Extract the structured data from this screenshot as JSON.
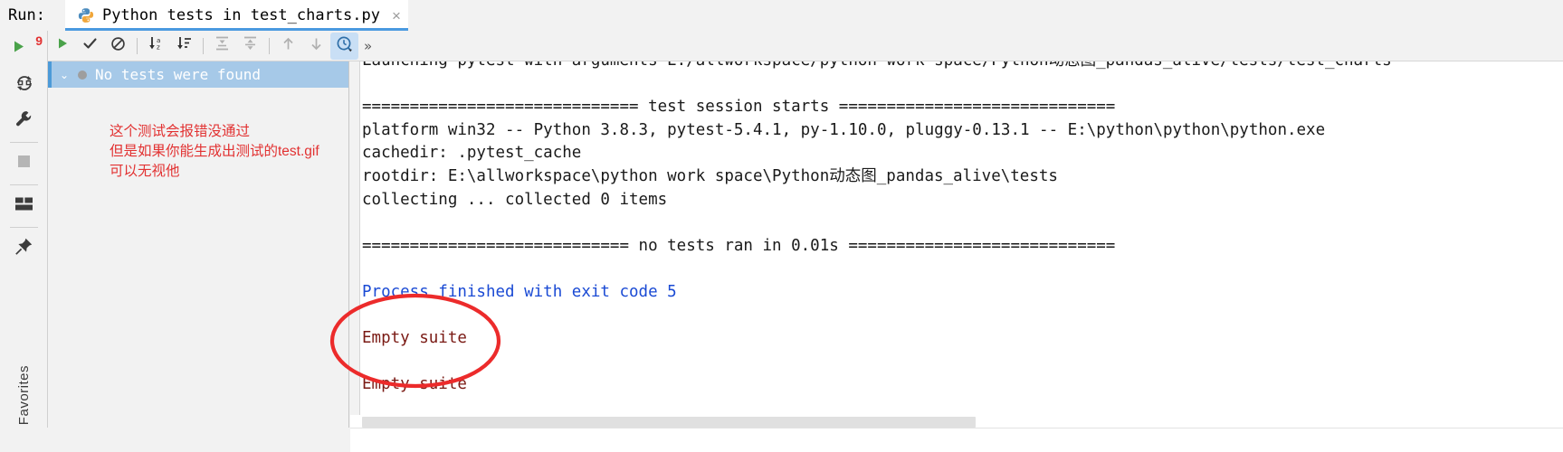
{
  "window": {
    "run_label": "Run:",
    "accent_color": "#4a9ae0",
    "annotation_color": "#e23232"
  },
  "tab": {
    "title": "Python tests in test_charts.py",
    "icon": "python-icon",
    "close_glyph": "×"
  },
  "toolbar": {
    "buttons": [
      {
        "name": "rerun-button",
        "icon": "play-icon",
        "label": "Rerun"
      },
      {
        "name": "show-passed-button",
        "icon": "checkmark-icon",
        "label": "Show Passed"
      },
      {
        "name": "show-ignored-button",
        "icon": "no-entry-icon",
        "label": "Show Ignored"
      },
      {
        "name": "sort-alphabetically-button",
        "icon": "sort-alpha-icon",
        "label": "Sort Alphabetically"
      },
      {
        "name": "sort-by-duration-button",
        "icon": "sort-duration-icon",
        "label": "Sort by Duration"
      },
      {
        "name": "expand-all-button",
        "icon": "expand-all-icon",
        "label": "Expand All"
      },
      {
        "name": "collapse-all-button",
        "icon": "collapse-all-icon",
        "label": "Collapse All"
      },
      {
        "name": "previous-failed-button",
        "icon": "arrow-up-icon",
        "label": "Previous Failed Test"
      },
      {
        "name": "next-failed-button",
        "icon": "arrow-down-icon",
        "label": "Next Failed Test"
      },
      {
        "name": "test-history-button",
        "icon": "clock-history-icon",
        "label": "Test History"
      }
    ],
    "more_glyph": "»"
  },
  "rail": {
    "items": [
      {
        "name": "rerun-tests-button",
        "icon": "play-with-badge-icon",
        "badge": "9"
      },
      {
        "name": "rerun-failed-button",
        "icon": "rerun-loop-icon",
        "badge": ""
      },
      {
        "name": "settings-button",
        "icon": "wrench-icon",
        "badge": ""
      },
      {
        "name": "stop-button",
        "icon": "stop-square-icon",
        "badge": ""
      },
      {
        "name": "layout-button",
        "icon": "layout-icon",
        "badge": ""
      },
      {
        "name": "pin-tab-button",
        "icon": "pin-icon",
        "badge": ""
      }
    ],
    "favorites_label": "Favorites",
    "favorites_icon": "star-icon"
  },
  "tree": {
    "chevron_glyph": "⌄",
    "root_label": "No tests were found",
    "status_icon": "gray-dot-icon"
  },
  "annotation": {
    "lines": [
      "这个测试会报错没通过",
      "但是如果你能生成出测试的test.gif",
      "可以无视他"
    ],
    "ellipse_name": "red-ellipse-annotation"
  },
  "console": {
    "lines": [
      {
        "text": "Launching pytest with arguments E:/allworkspace/python work space/Python动态图_pandas_alive/tests/test_charts",
        "color": "default"
      },
      {
        "text": "",
        "color": "default"
      },
      {
        "text": "============================= test session starts =============================",
        "color": "default"
      },
      {
        "text": "platform win32 -- Python 3.8.3, pytest-5.4.1, py-1.10.0, pluggy-0.13.1 -- E:\\python\\python\\python.exe",
        "color": "default"
      },
      {
        "text": "cachedir: .pytest_cache",
        "color": "default"
      },
      {
        "text": "rootdir: E:\\allworkspace\\python work space\\Python动态图_pandas_alive\\tests",
        "color": "default"
      },
      {
        "text": "collecting ... collected 0 items",
        "color": "default"
      },
      {
        "text": "",
        "color": "default"
      },
      {
        "text": "============================ no tests ran in 0.01s ============================",
        "color": "default"
      },
      {
        "text": "",
        "color": "default"
      },
      {
        "text": "Process finished with exit code 5",
        "color": "blue"
      },
      {
        "text": "",
        "color": "default"
      },
      {
        "text": "Empty suite",
        "color": "maroon"
      },
      {
        "text": "",
        "color": "default"
      },
      {
        "text": "Empty suite",
        "color": "maroon"
      }
    ]
  },
  "scrollbar": {
    "name": "horizontal-scrollbar"
  }
}
